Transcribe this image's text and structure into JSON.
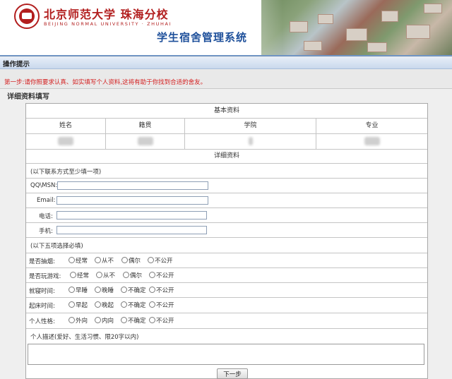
{
  "header": {
    "logo_cn": "北京师范大学 珠海分校",
    "logo_en": "BEIJING NORMAL UNIVERSITY · ZHUHAI",
    "system_title": "学生宿舍管理系统"
  },
  "tip_bar": {
    "title": "操作提示",
    "text": "第一步:请你照要求认真、如实填写个人资料,这将有助于你找到合适的舍友。"
  },
  "section": {
    "title": "详细资料填写"
  },
  "basic_info": {
    "title": "基本资料",
    "columns": [
      "姓名",
      "籍贯",
      "学院",
      "专业"
    ]
  },
  "detail_info": {
    "title": "详细资料",
    "contact_hint": "(以下联系方式至少填一项)",
    "contact_fields": [
      {
        "label": "QQ\\MSN:",
        "value": ""
      },
      {
        "label": "Email:",
        "value": ""
      },
      {
        "label": "电话:",
        "value": ""
      },
      {
        "label": "手机:",
        "value": ""
      }
    ],
    "choice_hint": "(以下五项选择必填)",
    "choices": [
      {
        "label": "是否抽烟:",
        "options": [
          "经常",
          "从不",
          "偶尔",
          "不公开"
        ]
      },
      {
        "label": "是否玩游戏:",
        "options": [
          "经常",
          "从不",
          "偶尔",
          "不公开"
        ]
      },
      {
        "label": "就寝时间:",
        "options": [
          "早睡",
          "晚睡",
          "不确定",
          "不公开"
        ]
      },
      {
        "label": "起床时间:",
        "options": [
          "早起",
          "晚起",
          "不确定",
          "不公开"
        ]
      },
      {
        "label": "个人性格:",
        "options": [
          "外向",
          "内向",
          "不确定",
          "不公开"
        ]
      }
    ],
    "description_label": "个人描述(爱好、生活习惯、限20字以内)",
    "description_value": ""
  },
  "actions": {
    "next_label": "下一步"
  },
  "colors": {
    "header_blue": "#1d4f9a",
    "school_red": "#b21e1e",
    "tip_red": "#d41e1e"
  }
}
